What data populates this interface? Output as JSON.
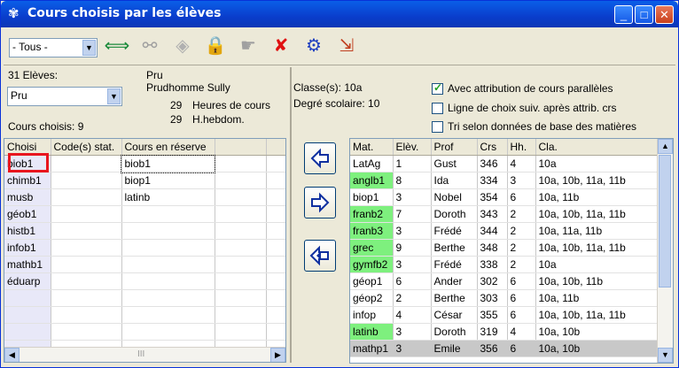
{
  "window": {
    "title": "Cours choisis par les élèves",
    "min": "_",
    "max": "□",
    "close": "✕"
  },
  "toolbar": {
    "filter_value": "- Tous -",
    "tools": [
      {
        "name": "swap-icon",
        "glyph": "⟺",
        "color": "#1a8a3a"
      },
      {
        "name": "binoculars-icon",
        "glyph": "⚯",
        "color": "#a0a0a0"
      },
      {
        "name": "diamond-icon",
        "glyph": "◈",
        "color": "#b0b0b0"
      },
      {
        "name": "lock-icon",
        "glyph": "🔒",
        "color": "#c8a000"
      },
      {
        "name": "hand-icon",
        "glyph": "☛",
        "color": "#a0a0a0"
      },
      {
        "name": "delete-icon",
        "glyph": "✘",
        "color": "#e01010"
      },
      {
        "name": "network-icon",
        "glyph": "⚙",
        "color": "#2040c0"
      },
      {
        "name": "export-icon",
        "glyph": "⇲",
        "color": "#c04020"
      }
    ]
  },
  "student": {
    "count_label": "31 Elèves:",
    "selected": "Pru",
    "short": "Pru",
    "full_name": "Prudhomme Sully",
    "hours_value": "29",
    "hours_label": "Heures de cours",
    "weekly_value": "29",
    "weekly_label": "H.hebdom.",
    "chosen_label": "Cours choisis: 9"
  },
  "left_table": {
    "headers": [
      "Choisi",
      "Code(s) stat.",
      "Cours en réserve"
    ],
    "rows": [
      [
        "biob1",
        "",
        "biob1"
      ],
      [
        "chimb1",
        "",
        "biop1"
      ],
      [
        "musb",
        "",
        "latinb"
      ],
      [
        "géob1",
        "",
        ""
      ],
      [
        "histb1",
        "",
        ""
      ],
      [
        "infob1",
        "",
        ""
      ],
      [
        "mathb1",
        "",
        ""
      ],
      [
        "éduarp",
        "",
        ""
      ]
    ],
    "scroll_mark": "III"
  },
  "right_info": {
    "classes": "Classe(s): 10a",
    "level": "Degré scolaire: 10",
    "opt1": "Avec attribution de cours parallèles",
    "opt2": "Ligne de choix suiv. après attrib. crs",
    "opt3": "Tri selon données de base des matières",
    "opt1_checked": true,
    "opt2_checked": false,
    "opt3_checked": false
  },
  "right_table": {
    "headers": [
      "Mat.",
      "Elèv.",
      "Prof",
      "Crs",
      "Hh.",
      "Cla."
    ],
    "rows": [
      {
        "cells": [
          "LatAg",
          "1",
          "Gust",
          "346",
          "4",
          "10a"
        ],
        "green": false
      },
      {
        "cells": [
          "anglb1",
          "8",
          "Ida",
          "334",
          "3",
          "10a, 10b, 11a, 11b"
        ],
        "green": true
      },
      {
        "cells": [
          "biop1",
          "3",
          "Nobel",
          "354",
          "6",
          "10a, 11b"
        ],
        "green": false
      },
      {
        "cells": [
          "franb2",
          "7",
          "Doroth",
          "343",
          "2",
          "10a, 10b, 11a, 11b"
        ],
        "green": true
      },
      {
        "cells": [
          "franb3",
          "3",
          "Frédé",
          "344",
          "2",
          "10a, 11a, 11b"
        ],
        "green": true
      },
      {
        "cells": [
          "grec",
          "9",
          "Berthe",
          "348",
          "2",
          "10a, 10b, 11a, 11b"
        ],
        "green": true
      },
      {
        "cells": [
          "gymfb2",
          "3",
          "Frédé",
          "338",
          "2",
          "10a"
        ],
        "green": true
      },
      {
        "cells": [
          "géop1",
          "6",
          "Ander",
          "302",
          "6",
          "10a, 10b, 11b"
        ],
        "green": false
      },
      {
        "cells": [
          "géop2",
          "2",
          "Berthe",
          "303",
          "6",
          "10a, 11b"
        ],
        "green": false
      },
      {
        "cells": [
          "infop",
          "4",
          "César",
          "355",
          "6",
          "10a, 10b, 11a, 11b"
        ],
        "green": false
      },
      {
        "cells": [
          "latinb",
          "3",
          "Doroth",
          "319",
          "4",
          "10a, 10b"
        ],
        "green": true
      },
      {
        "cells": [
          "mathp1",
          "3",
          "Emile",
          "356",
          "6",
          "10a, 10b"
        ],
        "green": true,
        "selected": true
      }
    ]
  }
}
